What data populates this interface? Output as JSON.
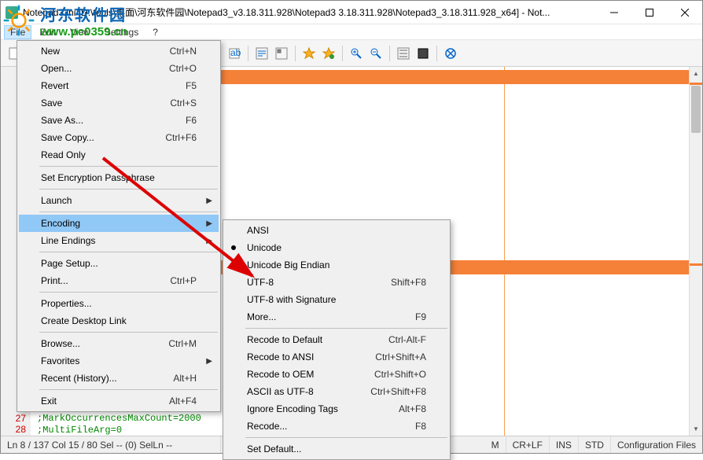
{
  "title": "Notepad3.ini [D:\\tools\\桌面\\河东软件园\\Notepad3_v3.18.311.928\\Notepad3 3.18.311.928\\Notepad3_3.18.311.928_x64] - Not...",
  "menubar": [
    "File",
    "Edit",
    "View",
    "Settings",
    "?"
  ],
  "watermark": {
    "cn": "河东软件园",
    "url": "www.pc0359.cn"
  },
  "file_menu": [
    {
      "label": "New",
      "sc": "Ctrl+N"
    },
    {
      "label": "Open...",
      "sc": "Ctrl+O"
    },
    {
      "label": "Revert",
      "sc": "F5"
    },
    {
      "label": "Save",
      "sc": "Ctrl+S"
    },
    {
      "label": "Save As...",
      "sc": "F6"
    },
    {
      "label": "Save Copy...",
      "sc": "Ctrl+F6"
    },
    {
      "label": "Read Only",
      "sep_after": true
    },
    {
      "label": "Set Encryption Passphrase",
      "sep_after": true
    },
    {
      "label": "Launch",
      "sub": true,
      "sep_after": true
    },
    {
      "label": "Encoding",
      "sub": true,
      "sel": true
    },
    {
      "label": "Line Endings",
      "sub": true,
      "sep_after": true
    },
    {
      "label": "Page Setup..."
    },
    {
      "label": "Print...",
      "sc": "Ctrl+P",
      "sep_after": true
    },
    {
      "label": "Properties..."
    },
    {
      "label": "Create Desktop Link",
      "sep_after": true
    },
    {
      "label": "Browse...",
      "sc": "Ctrl+M"
    },
    {
      "label": "Favorites",
      "sub": true
    },
    {
      "label": "Recent (History)...",
      "sc": "Alt+H",
      "sep_after": true
    },
    {
      "label": "Exit",
      "sc": "Alt+F4"
    }
  ],
  "encoding_menu": [
    {
      "label": "ANSI"
    },
    {
      "label": "Unicode",
      "bullet": true
    },
    {
      "label": "Unicode Big Endian"
    },
    {
      "label": "UTF-8",
      "sc": "Shift+F8"
    },
    {
      "label": "UTF-8 with Signature"
    },
    {
      "label": "More...",
      "sc": "F9",
      "sep_after": true
    },
    {
      "label": "Recode to Default",
      "sc": "Ctrl-Alt-F"
    },
    {
      "label": "Recode to ANSI",
      "sc": "Ctrl+Shift+A"
    },
    {
      "label": "Recode to OEM",
      "sc": "Ctrl+Shift+O"
    },
    {
      "label": "ASCII as UTF-8",
      "sc": "Ctrl+Shift+F8"
    },
    {
      "label": "Ignore Encoding Tags",
      "sc": "Alt+F8"
    },
    {
      "label": "Recode...",
      "sc": "F8",
      "sep_after": true
    },
    {
      "label": "Set Default..."
    }
  ],
  "code": {
    "27": ";MarkOccurrencesMaxCount=2000",
    "28": ";MultiFileArg=0"
  },
  "status": {
    "pos": "Ln 8 / 137   Col 15 / 80   Sel -- (0)   SelLn --",
    "enc_partial": "M",
    "eol": "CR+LF",
    "ins": "INS",
    "std": "STD",
    "scheme": "Configuration Files"
  }
}
